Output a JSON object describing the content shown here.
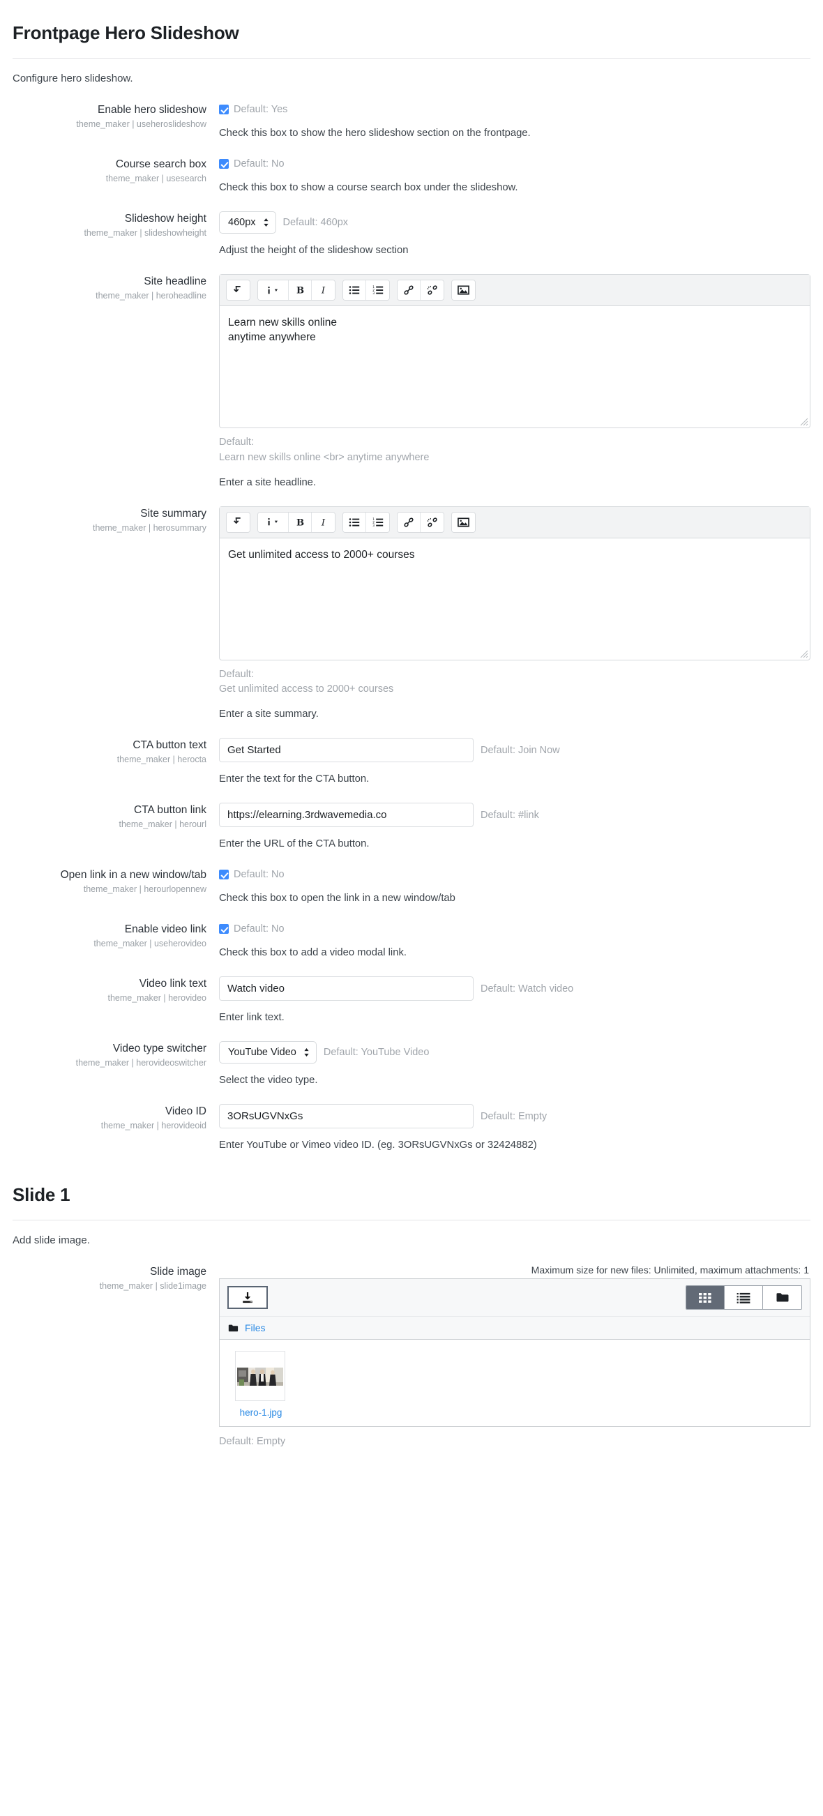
{
  "header": {
    "title": "Frontpage Hero Slideshow",
    "description": "Configure hero slideshow."
  },
  "settings": [
    {
      "name": "Enable hero slideshow",
      "key": "theme_maker | useheroslideshow",
      "type": "checkbox",
      "checked": true,
      "default_note": "Default: Yes",
      "help": "Check this box to show the hero slideshow section on the frontpage."
    },
    {
      "name": "Course search box",
      "key": "theme_maker | usesearch",
      "type": "checkbox",
      "checked": true,
      "default_note": "Default: No",
      "help": "Check this box to show a course search box under the slideshow."
    },
    {
      "name": "Slideshow height",
      "key": "theme_maker | slideshowheight",
      "type": "select",
      "value": "460px",
      "default_note": "Default: 460px",
      "help": "Adjust the height of the slideshow section"
    },
    {
      "name": "Site headline",
      "key": "theme_maker | heroheadline",
      "type": "editor",
      "value": "Learn new skills online\nanytime anywhere",
      "default_label": "Default:",
      "default_value": "Learn new skills online <br> anytime anywhere",
      "help": "Enter a site headline."
    },
    {
      "name": "Site summary",
      "key": "theme_maker | herosummary",
      "type": "editor",
      "value": "Get unlimited access to 2000+ courses",
      "default_label": "Default:",
      "default_value": "Get unlimited access to 2000+ courses",
      "help": "Enter a site summary."
    },
    {
      "name": "CTA button text",
      "key": "theme_maker | herocta",
      "type": "text",
      "value": "Get Started",
      "default_note": "Default: Join Now",
      "help": "Enter the text for the CTA button."
    },
    {
      "name": "CTA button link",
      "key": "theme_maker | herourl",
      "type": "text",
      "value": "https://elearning.3rdwavemedia.co",
      "default_note": "Default: #link",
      "help": "Enter the URL of the CTA button."
    },
    {
      "name": "Open link in a new window/tab",
      "key": "theme_maker | herourlopennew",
      "type": "checkbox",
      "checked": true,
      "default_note": "Default: No",
      "help": "Check this box to open the link in a new window/tab"
    },
    {
      "name": "Enable video link",
      "key": "theme_maker | useherovideo",
      "type": "checkbox",
      "checked": true,
      "default_note": "Default: No",
      "help": "Check this box to add a video modal link."
    },
    {
      "name": "Video link text",
      "key": "theme_maker | herovideo",
      "type": "text",
      "value": "Watch video",
      "default_note": "Default: Watch video",
      "help": "Enter link text."
    },
    {
      "name": "Video type switcher",
      "key": "theme_maker | herovideoswitcher",
      "type": "select",
      "value": "YouTube Video",
      "default_note": "Default: YouTube Video",
      "help": "Select the video type."
    },
    {
      "name": "Video ID",
      "key": "theme_maker | herovideoid",
      "type": "text",
      "value": "3ORsUGVNxGs",
      "default_note": "Default: Empty",
      "help": "Enter YouTube or Vimeo video ID. (eg. 3ORsUGVNxGs or 32424882)"
    }
  ],
  "toolbar_icons": [
    {
      "name": "undo-icon",
      "label": "Undo"
    },
    {
      "name": "info-dropdown-icon",
      "label": "Styles"
    },
    {
      "name": "bold-icon",
      "label": "Bold"
    },
    {
      "name": "italic-icon",
      "label": "Italic"
    },
    {
      "name": "bullet-list-icon",
      "label": "Bulleted list"
    },
    {
      "name": "numbered-list-icon",
      "label": "Numbered list"
    },
    {
      "name": "link-icon",
      "label": "Link"
    },
    {
      "name": "unlink-icon",
      "label": "Unlink"
    },
    {
      "name": "image-icon",
      "label": "Image"
    }
  ],
  "slide_section": {
    "title": "Slide 1",
    "description": "Add slide image.",
    "setting_name": "Slide image",
    "setting_key": "theme_maker | slide1image",
    "max_note": "Maximum size for new files: Unlimited, maximum attachments: 1",
    "breadcrumb": "Files",
    "file_name": "hero-1.jpg",
    "default_note": "Default: Empty",
    "views": [
      {
        "name": "grid-view-button",
        "label": "Icons view",
        "active": true
      },
      {
        "name": "list-view-button",
        "label": "List view",
        "active": false
      },
      {
        "name": "tree-view-button",
        "label": "Tree view",
        "active": false
      }
    ],
    "upload_label": "Add..."
  },
  "colors": {
    "checkbox": "#3d8bfd",
    "link": "#2b8ae4",
    "muted": "#a0a5ab",
    "active_view": "#626a76"
  }
}
